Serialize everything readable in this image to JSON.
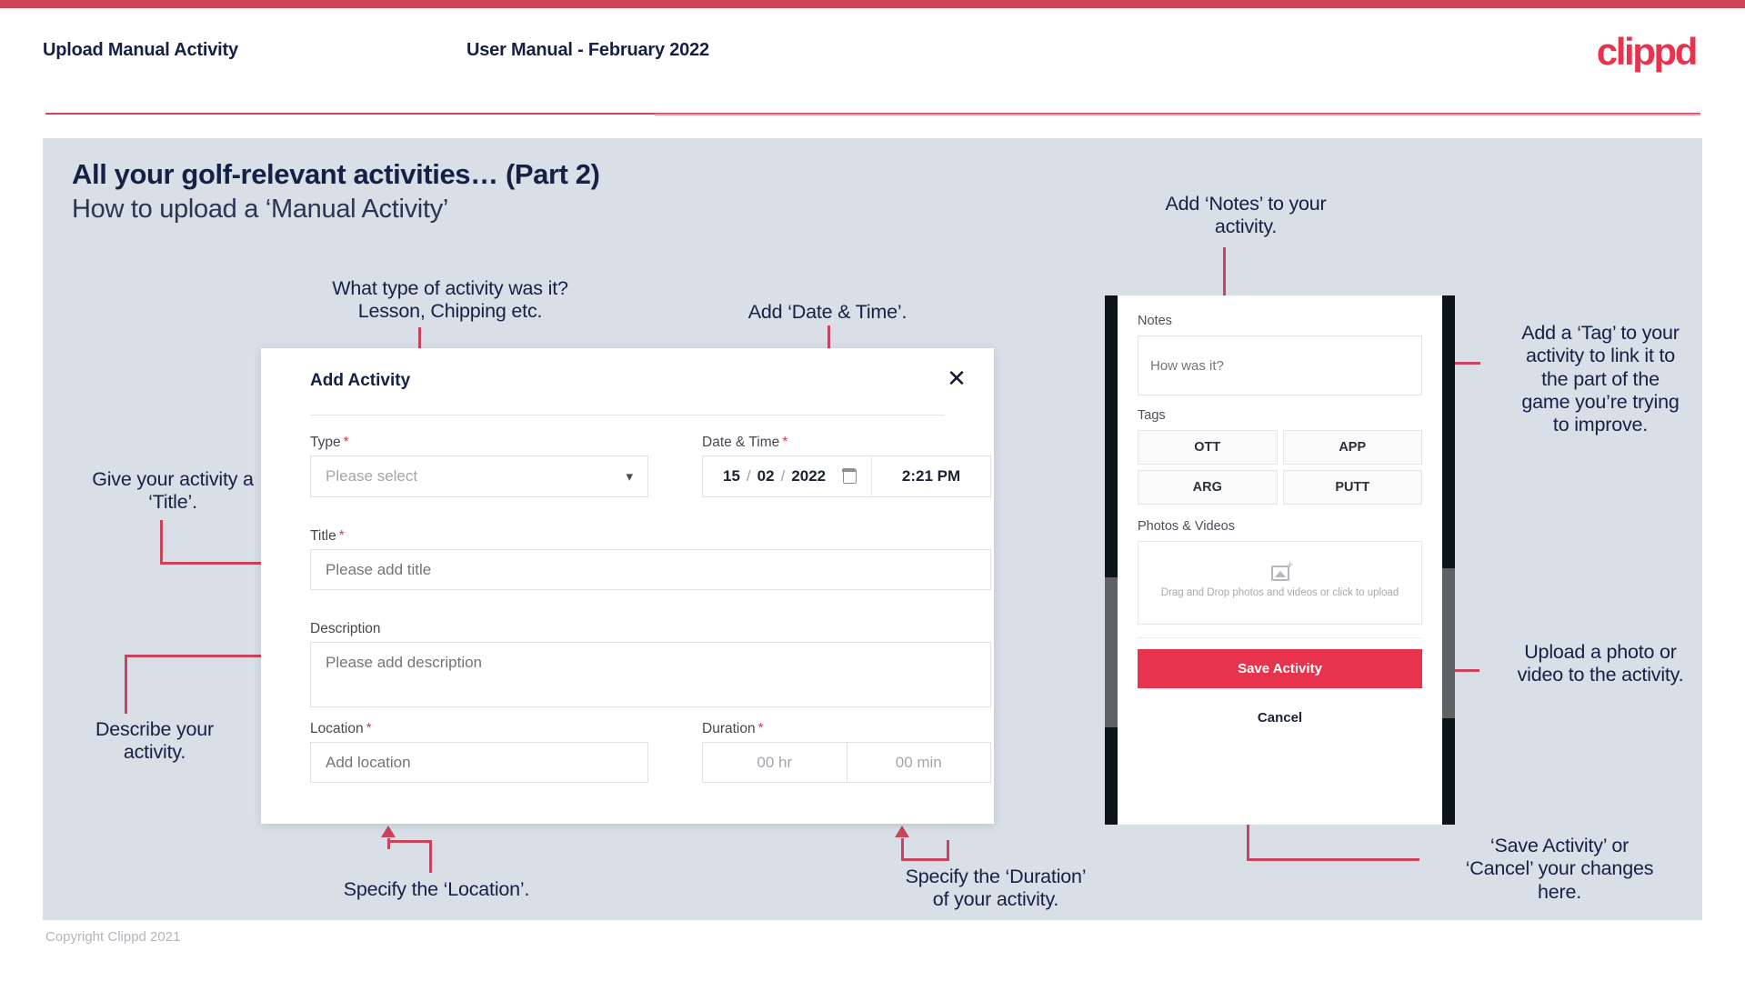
{
  "header": {
    "title": "Upload Manual Activity",
    "subtitle": "User Manual - February 2022",
    "brand": "clippd"
  },
  "slide": {
    "title": "All your golf-relevant activities… (Part 2)",
    "subtitle": "How to upload a ‘Manual Activity’"
  },
  "annotations": {
    "type": "What type of activity was it?\nLesson, Chipping etc.",
    "datetime": "Add ‘Date & Time’.",
    "notes": "Add ‘Notes’ to your\nactivity.",
    "tag": "Add a ‘Tag’ to your\nactivity to link it to\nthe part of the\ngame you’re trying\nto improve.",
    "title_field": "Give your activity a\n‘Title’.",
    "description": "Describe your\nactivity.",
    "location": "Specify the ‘Location’.",
    "duration": "Specify the ‘Duration’\nof your activity.",
    "upload": "Upload a photo or\nvideo to the activity.",
    "save_cancel": "‘Save Activity’ or\n‘Cancel’ your changes\nhere."
  },
  "dialog": {
    "title": "Add Activity",
    "close_icon": "✕",
    "fields": {
      "type_label": "Type",
      "type_value": "Please select",
      "datetime_label": "Date & Time",
      "date_day": "15",
      "date_month": "02",
      "date_year": "2022",
      "date_sep": "/",
      "time_value": "2:21 PM",
      "title_label": "Title",
      "title_placeholder": "Please add title",
      "description_label": "Description",
      "description_placeholder": "Please add description",
      "location_label": "Location",
      "location_placeholder": "Add location",
      "duration_label": "Duration",
      "duration_hours": "00 hr",
      "duration_minutes": "00 min"
    },
    "required_mark": "*"
  },
  "phone": {
    "notes_label": "Notes",
    "notes_placeholder": "How was it?",
    "tags_label": "Tags",
    "tags": [
      "OTT",
      "APP",
      "ARG",
      "PUTT"
    ],
    "photos_label": "Photos & Videos",
    "drop_text": "Drag and Drop photos and videos or click to upload",
    "save_label": "Save Activity",
    "cancel_label": "Cancel"
  },
  "footer": {
    "copyright": "Copyright Clippd 2021"
  },
  "colors": {
    "brand_red": "#e8334f",
    "accent_line": "#c9445c",
    "slide_bg": "#d9dfe7",
    "text_dark": "#152144"
  }
}
